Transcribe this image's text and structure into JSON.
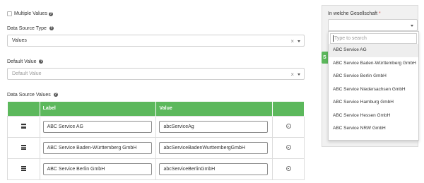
{
  "form": {
    "multiple_values_label": "Multiple Values",
    "data_source_type_label": "Data Source Type",
    "data_source_type_value": "Values",
    "default_value_label": "Default Value",
    "default_value_placeholder": "Default Value",
    "data_source_values_label": "Data Source Values",
    "clear_glyph": "×"
  },
  "table": {
    "headers": [
      "",
      "Label",
      "Value",
      ""
    ],
    "rows": [
      {
        "label": "ABC Service AG",
        "value": "abcServiceAg"
      },
      {
        "label": "ABC Service Baden-Württemberg GmbH",
        "value": "abcServiceBadenWurttembergGmbH"
      },
      {
        "label": "ABC Service Berlin GmbH",
        "value": "abcServiceBerlinGmbH"
      }
    ]
  },
  "right": {
    "title": "In welche Gesellschaft",
    "required_mark": "*",
    "search_placeholder": "Type to search",
    "options": [
      "ABC Service AG",
      "ABC Service Baden-Württemberg GmbH",
      "ABC Service Berlin GmbH",
      "ABC Service Niedersachsen GmbH",
      "ABC Service Hamburg GmbH",
      "ABC Service Hessen GmbH",
      "ABC Service NRW GmbH"
    ],
    "active_option": "ABC Service AG",
    "button_stub": "S"
  },
  "colors": {
    "table_header": "#5cb85c",
    "panel_bg": "#f1f1f1",
    "required": "#d9534f"
  },
  "icons": {
    "help": "question-circle-icon",
    "clear": "close-icon",
    "caret": "chevron-down-icon",
    "drag": "drag-handle-icon",
    "remove": "remove-circle-icon"
  }
}
